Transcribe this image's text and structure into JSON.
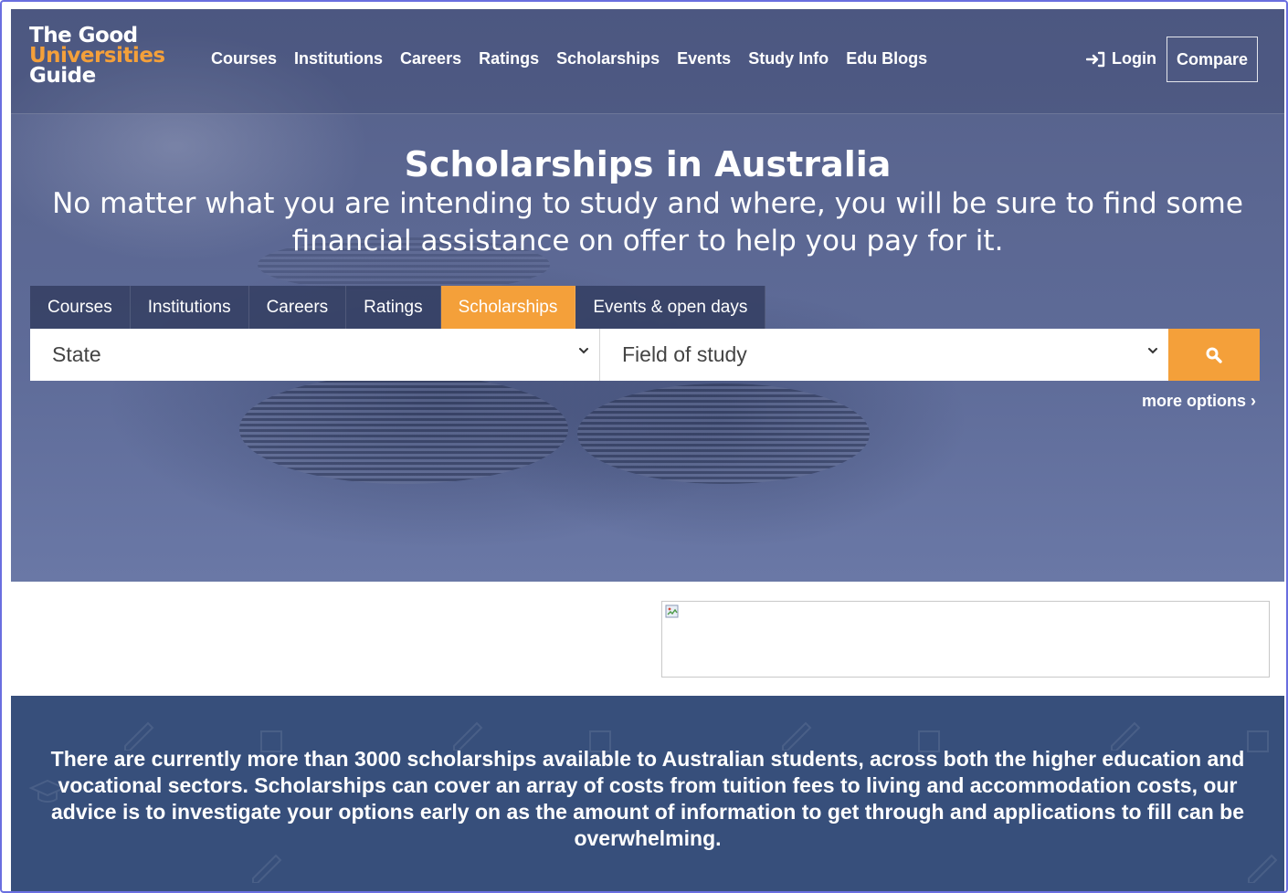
{
  "logo": {
    "line1": "The Good",
    "line2": "Universities",
    "line3": "Guide",
    "accent": "#f4a03a"
  },
  "nav": {
    "links": [
      "Courses",
      "Institutions",
      "Careers",
      "Ratings",
      "Scholarships",
      "Events",
      "Study Info",
      "Edu Blogs"
    ],
    "login_label": "Login",
    "login_icon": "sign-in-icon",
    "compare_label": "Compare"
  },
  "hero": {
    "title": "Scholarships in Australia",
    "subtitle": "No matter what you are intending to study and where, you will be sure to find some financial assistance on offer to help you pay for it."
  },
  "search_tabs": {
    "tabs": [
      "Courses",
      "Institutions",
      "Careers",
      "Ratings",
      "Scholarships",
      "Events & open days"
    ],
    "active": "Scholarships"
  },
  "search": {
    "state_value": "State",
    "field_value": "Field of study",
    "search_icon": "search-icon",
    "more_options": "more options ›"
  },
  "ad": {
    "image": "broken-image-icon"
  },
  "info": {
    "text": "There are currently more than 3000 scholarships available to Australian students, across both the higher education and vocational sectors. Scholarships can cover an array of costs from tuition fees to living and accommodation costs, our advice is to investigate your options early on as the amount of information to get through and applications to fill can be overwhelming."
  },
  "colors": {
    "accent": "#f4a03a",
    "band": "#374f7b",
    "tab_bg": "#343e62"
  }
}
